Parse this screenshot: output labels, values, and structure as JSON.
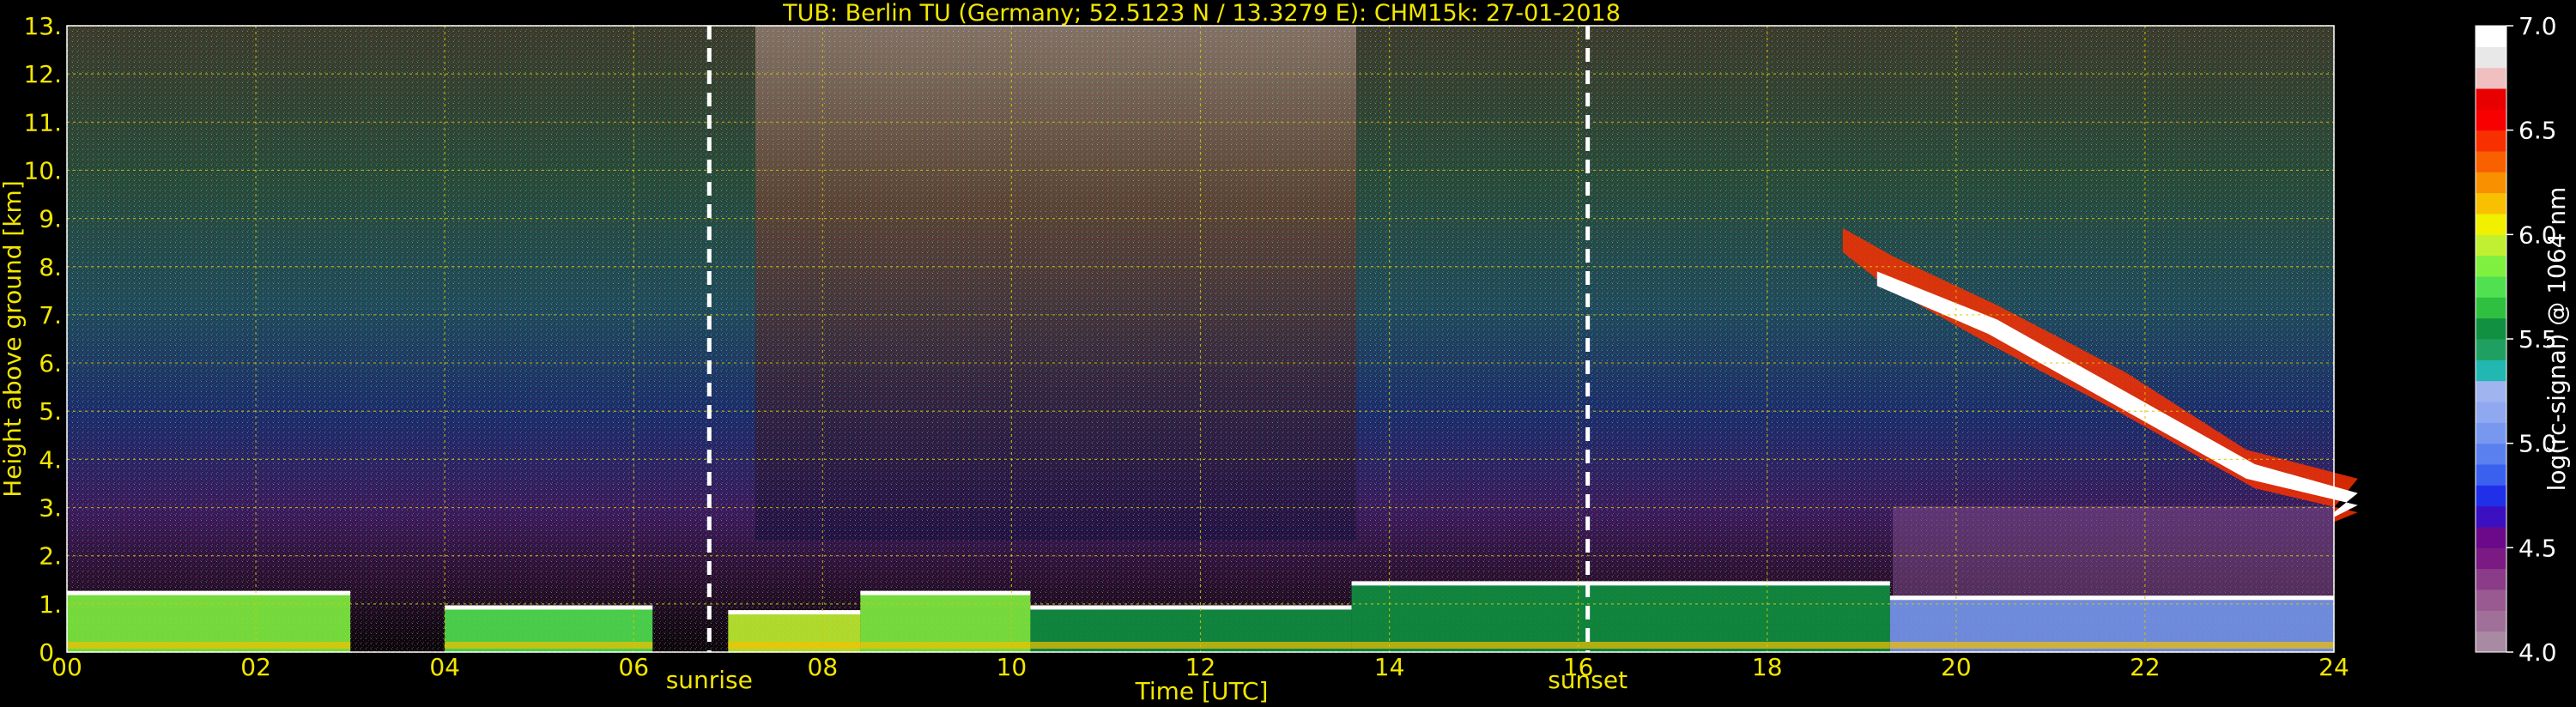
{
  "chart_data": {
    "type": "heatmap",
    "title": "TUB: Berlin TU (Germany; 52.5123 N / 13.3279 E):    CHM15k: 27-01-2018",
    "xlabel": "Time [UTC]",
    "ylabel": "Height above ground [km]",
    "xlim": [
      0,
      24
    ],
    "ylim": [
      0,
      13
    ],
    "x_ticks": [
      0,
      2,
      4,
      6,
      8,
      10,
      12,
      14,
      16,
      18,
      20,
      22,
      24
    ],
    "x_tick_labels": [
      "00",
      "02",
      "04",
      "06",
      "08",
      "10",
      "12",
      "14",
      "16",
      "18",
      "20",
      "22",
      "24"
    ],
    "y_ticks": [
      0,
      1,
      2,
      3,
      4,
      5,
      6,
      7,
      8,
      9,
      10,
      11,
      12,
      13
    ],
    "y_tick_labels": [
      "0.",
      "1.",
      "2.",
      "3.",
      "4.",
      "5.",
      "6.",
      "7.",
      "8.",
      "9.",
      "10.",
      "11.",
      "12.",
      "13."
    ],
    "grid": true,
    "markers": [
      {
        "label": "sunrise",
        "x": 6.8
      },
      {
        "label": "sunset",
        "x": 16.1
      }
    ],
    "colorbar": {
      "label": "log(rc-signal) @ 1064 nm",
      "range": [
        4.0,
        7.0
      ],
      "ticks": [
        4.0,
        4.5,
        5.0,
        5.5,
        6.0,
        6.5,
        7.0
      ],
      "tick_labels": [
        "4.0",
        "4.5",
        "5.0",
        "5.5",
        "6.0",
        "6.5",
        "7.0"
      ],
      "colors": [
        "#a88aa3",
        "#a07098",
        "#985a90",
        "#8a3c88",
        "#7a1a82",
        "#6a0a8a",
        "#3a10c0",
        "#2030e8",
        "#3a60f0",
        "#5a80f0",
        "#7898f0",
        "#90a8f0",
        "#a0b4f0",
        "#20b8b0",
        "#20a060",
        "#109040",
        "#30c040",
        "#50e050",
        "#80f040",
        "#c0f030",
        "#f0f000",
        "#f8c000",
        "#f89000",
        "#f86000",
        "#f83000",
        "#f80000",
        "#e80000",
        "#f0c0c0",
        "#e8e8e8",
        "#ffffff"
      ]
    },
    "features": [
      {
        "kind": "boundary-layer",
        "x": [
          0.0,
          3.0
        ],
        "y": [
          0.0,
          1.2
        ],
        "level": 5.8
      },
      {
        "kind": "boundary-layer",
        "x": [
          4.0,
          6.2
        ],
        "y": [
          0.0,
          0.9
        ],
        "level": 5.7
      },
      {
        "kind": "boundary-layer",
        "x": [
          7.0,
          8.4
        ],
        "y": [
          0.0,
          0.8
        ],
        "level": 5.9
      },
      {
        "kind": "boundary-layer",
        "x": [
          8.4,
          10.2
        ],
        "y": [
          0.0,
          1.2
        ],
        "level": 5.8
      },
      {
        "kind": "boundary-layer",
        "x": [
          10.2,
          13.6
        ],
        "y": [
          0.0,
          0.9
        ],
        "level": 5.6
      },
      {
        "kind": "boundary-layer",
        "x": [
          13.6,
          19.3
        ],
        "y": [
          0.0,
          1.4
        ],
        "level": 5.5
      },
      {
        "kind": "boundary-layer",
        "x": [
          19.3,
          24.0
        ],
        "y": [
          0.0,
          1.1
        ],
        "level": 5.1
      },
      {
        "kind": "cirrus-cloud",
        "x": [
          18.8,
          24.0
        ],
        "y": [
          2.8,
          8.8
        ],
        "level": 6.9
      }
    ]
  }
}
